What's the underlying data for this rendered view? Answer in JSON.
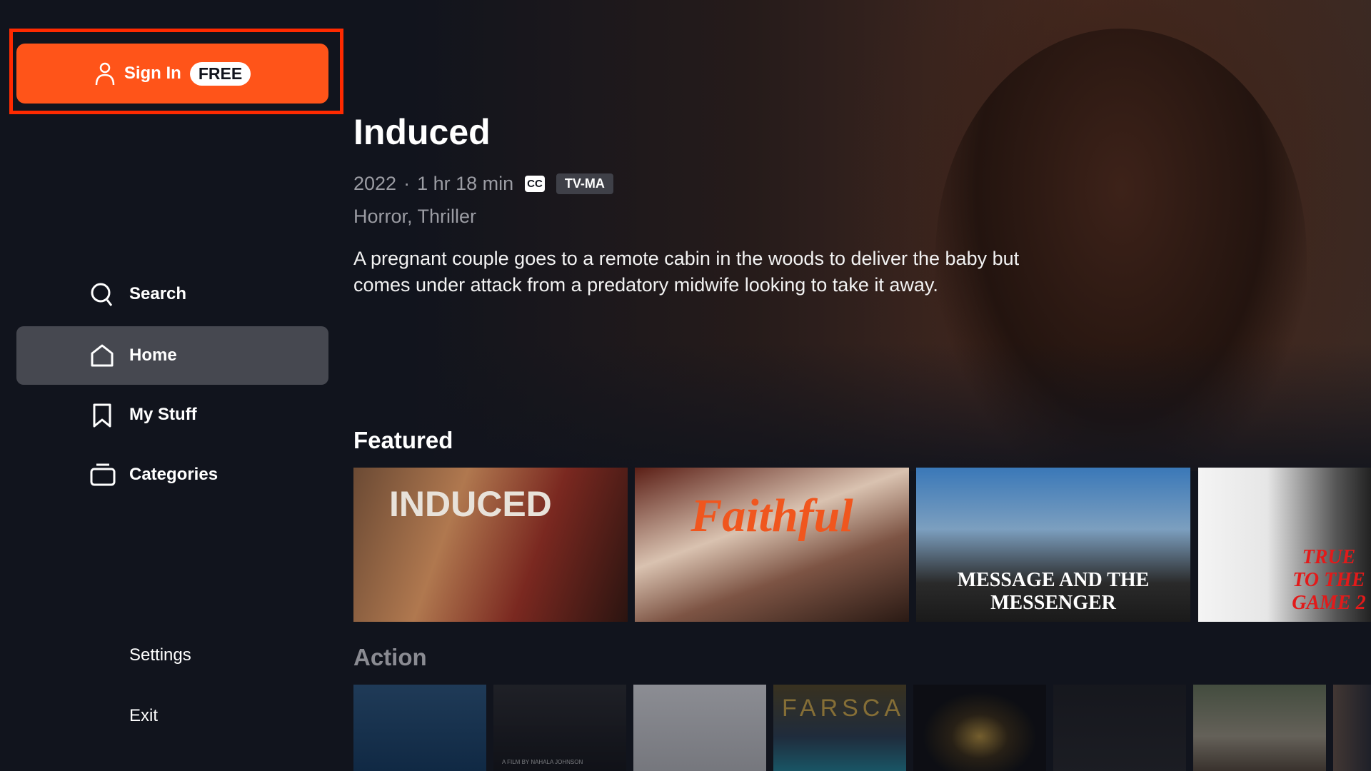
{
  "sidebar": {
    "sign_in": {
      "label": "Sign In",
      "badge": "FREE"
    },
    "nav": [
      {
        "label": "Search",
        "icon": "search-icon"
      },
      {
        "label": "Home",
        "icon": "home-icon",
        "active": true
      },
      {
        "label": "My Stuff",
        "icon": "bookmark-icon"
      },
      {
        "label": "Categories",
        "icon": "categories-icon"
      }
    ],
    "settings": "Settings",
    "exit": "Exit"
  },
  "hero": {
    "title": "Induced",
    "year": "2022",
    "separator": "·",
    "duration": "1 hr 18 min",
    "cc": "CC",
    "rating": "TV-MA",
    "genres": "Horror, Thriller",
    "description": "A pregnant couple goes to a remote cabin in the woods to deliver the baby but comes under attack from a predatory midwife looking to take it away."
  },
  "rows": {
    "featured": {
      "label": "Featured",
      "items": [
        "INDUCED",
        "Faithful",
        "MESSAGE AND THE MESSENGER",
        "TRUE TO THE GAME 2"
      ]
    },
    "action": {
      "label": "Action",
      "items": [
        "",
        "A FILM BY NAHALA JOHNSON",
        "",
        "FARSCAPE",
        "",
        "",
        "",
        ""
      ]
    }
  },
  "colors": {
    "accent": "#ff5419",
    "highlight_outline": "#ff2a00",
    "background": "#11141d",
    "nav_active": "#464850"
  }
}
